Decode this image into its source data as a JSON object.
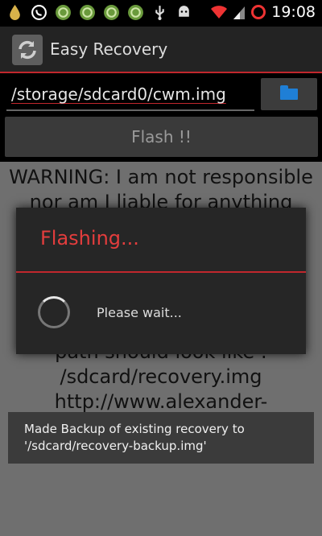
{
  "status_bar": {
    "time": "19:08",
    "icons": [
      "drop-icon",
      "whatsapp-icon",
      "green-circle-icon",
      "green-circle-icon",
      "green-circle-icon",
      "green-circle-icon",
      "usb-icon",
      "android-icon",
      "wifi-icon",
      "signal-icon",
      "alarm-icon"
    ]
  },
  "action_bar": {
    "title": "Easy Recovery",
    "icon": "recovery-app-icon"
  },
  "main": {
    "path_value": "/storage/sdcard0/cwm.img",
    "browse_icon": "folder-icon",
    "flash_label": "Flash !!",
    "warning_text": "WARNING: I am not responsible nor am I liable for anything that happens to your device. Please use it at your own risk. This may also void your warranty or be considered as violating your warranty. Your path should look like : /sdcard/recovery.img http://www.alexander-fuchs.net/"
  },
  "dialog": {
    "title": "Flashing...",
    "message": "Please wait..."
  },
  "toast": {
    "message": "Made Backup of existing recovery to '/sdcard/recovery-backup.img'"
  },
  "colors": {
    "accent": "#c1272d",
    "dialog_title": "#e33d3d",
    "warning_bg": "#6f6f6f",
    "folder": "#1f7fd6"
  }
}
